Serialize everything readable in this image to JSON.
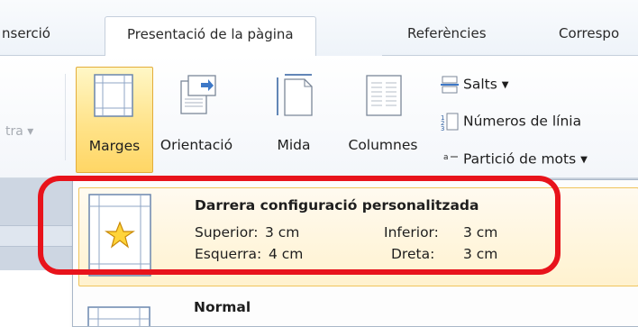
{
  "tabs": [
    "nserció",
    "Presentació de la pàgina",
    "Referències",
    "Correspo"
  ],
  "ribbon": {
    "faded_group_text": "tra ▾",
    "big_buttons": [
      {
        "label": "Marges",
        "icon": "margins-icon"
      },
      {
        "label": "Orientació",
        "icon": "orientation-icon"
      },
      {
        "label": "Mida",
        "icon": "size-icon"
      },
      {
        "label": "Columnes",
        "icon": "columns-icon"
      }
    ],
    "small_commands": [
      {
        "label": "Salts ▾",
        "icon": "breaks-icon"
      },
      {
        "label": "Números de línia",
        "icon": "line-numbers-icon"
      },
      {
        "label": "Partició de mots ▾",
        "icon": "hyphenation-icon"
      }
    ]
  },
  "margins_menu": {
    "last_custom": {
      "title": "Darrera configuració personalitzada",
      "top_label": "Superior:",
      "top_value": "3 cm",
      "bottom_label": "Inferior:",
      "bottom_value": "3 cm",
      "left_label": "Esquerra:",
      "left_value": "4 cm",
      "right_label": "Dreta:",
      "right_value": "3 cm"
    },
    "normal": {
      "title": "Normal"
    }
  },
  "colors": {
    "highlight_ring": "#e8131b",
    "active_button": "#ffd665"
  }
}
